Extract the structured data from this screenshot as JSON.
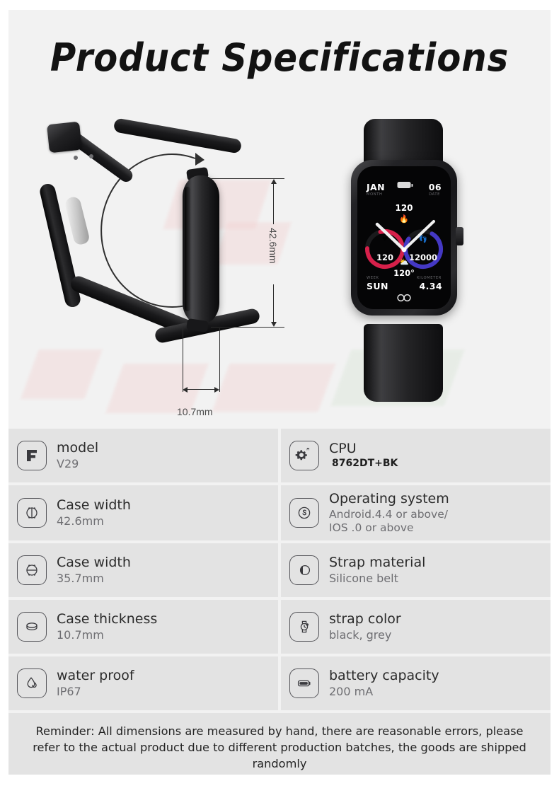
{
  "header": {
    "title": "Product Specifications"
  },
  "diagram": {
    "height_dimension": "42.6mm",
    "thickness_dimension": "10.7mm",
    "strap_loop_icon": "circular-arrow-arc",
    "side_view_icon": "watch-side-profile",
    "front_view_icon": "watch-front-view"
  },
  "watch_face": {
    "month_value": "JAN",
    "month_label": "MONTH",
    "date_value": "06",
    "date_label": "DATE",
    "week_value": "SUN",
    "week_label": "WEEK",
    "kilometer_value": "4.34",
    "kilometer_label": "KILOMETER",
    "calories_value": "120",
    "calories_icon": "flame-icon",
    "heart_rate_value": "120",
    "heart_rate_icon": "heart-icon",
    "steps_value": "12000",
    "steps_icon": "footsteps-icon",
    "temperature_value": "120°",
    "weather_icon": "sun-cloud-icon",
    "battery_icon": "battery-icon",
    "link_icon": "link-chain-icon",
    "heart_ring_color": "#d6204a",
    "steps_ring_color": "#4438c4"
  },
  "specs": {
    "rows": [
      {
        "left": {
          "icon": "model-tag-icon",
          "label": "model",
          "value": "V29",
          "value_style": "normal"
        },
        "right": {
          "icon": "gears-icon",
          "label": "CPU",
          "value": "8762DT+BK",
          "value_style": "strong"
        }
      },
      {
        "left": {
          "icon": "case-width-icon",
          "label": "Case width",
          "value": "42.6mm",
          "value_style": "normal"
        },
        "right": {
          "icon": "os-circle-s-icon",
          "label": "Operating system",
          "value": "Android.4.4 or above/\nIOS  .0 or above",
          "value_style": "os"
        }
      },
      {
        "left": {
          "icon": "case-height-icon",
          "label": "Case width",
          "value": "35.7mm",
          "value_style": "normal"
        },
        "right": {
          "icon": "strap-material-icon",
          "label": "Strap material",
          "value": "Silicone belt",
          "value_style": "normal"
        }
      },
      {
        "left": {
          "icon": "case-thickness-icon",
          "label": "Case thickness",
          "value": "10.7mm",
          "value_style": "normal"
        },
        "right": {
          "icon": "watch-color-icon",
          "label": "strap color",
          "value": "black, grey",
          "value_style": "normal"
        }
      },
      {
        "left": {
          "icon": "water-drop-icon",
          "label": "water proof",
          "value": "IP67",
          "value_style": "normal"
        },
        "right": {
          "icon": "battery-icon",
          "label": "battery capacity",
          "value": "200 mA",
          "value_style": "normal"
        }
      }
    ],
    "reminder": "Reminder: All dimensions are measured by hand, there are reasonable errors, please refer to the actual product due to different production batches, the goods are shipped randomly"
  }
}
